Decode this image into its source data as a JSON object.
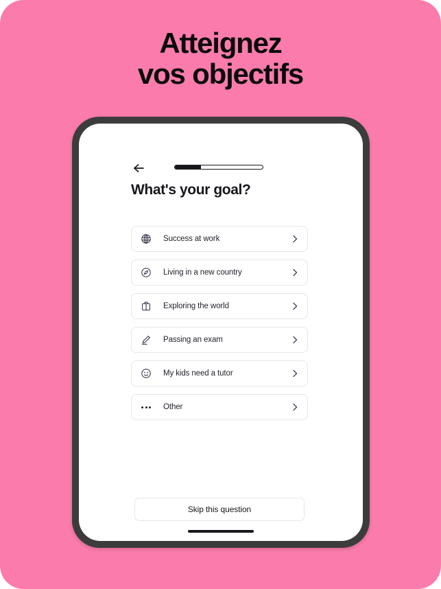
{
  "promo": {
    "background_color": "#fb7cac",
    "headline_line1": "Atteignez",
    "headline_line2": "vos objectifs",
    "headline_color": "#0b0b0b"
  },
  "device": {
    "bezel_color": "#3c3c3c",
    "screen_color": "#ffffff",
    "home_indicator": "home-indicator"
  },
  "screen": {
    "topbar": {
      "back_icon": "arrow-left-icon",
      "progress": {
        "percent": 30,
        "fill_color": "#17171c",
        "track_color": "#ffffff"
      }
    },
    "question_title": "What's your goal?",
    "options": [
      {
        "icon": "globe-icon",
        "label": "Success at work",
        "chevron": "chevron-right-icon"
      },
      {
        "icon": "compass-icon",
        "label": "Living in a new country",
        "chevron": "chevron-right-icon"
      },
      {
        "icon": "briefcase-icon",
        "label": "Exploring the world",
        "chevron": "chevron-right-icon"
      },
      {
        "icon": "pencil-icon",
        "label": "Passing an exam",
        "chevron": "chevron-right-icon"
      },
      {
        "icon": "smiley-icon",
        "label": "My kids need a tutor",
        "chevron": "chevron-right-icon"
      },
      {
        "icon": "ellipsis-icon",
        "label": "Other",
        "chevron": "chevron-right-icon"
      }
    ],
    "skip_button_label": "Skip this question"
  }
}
